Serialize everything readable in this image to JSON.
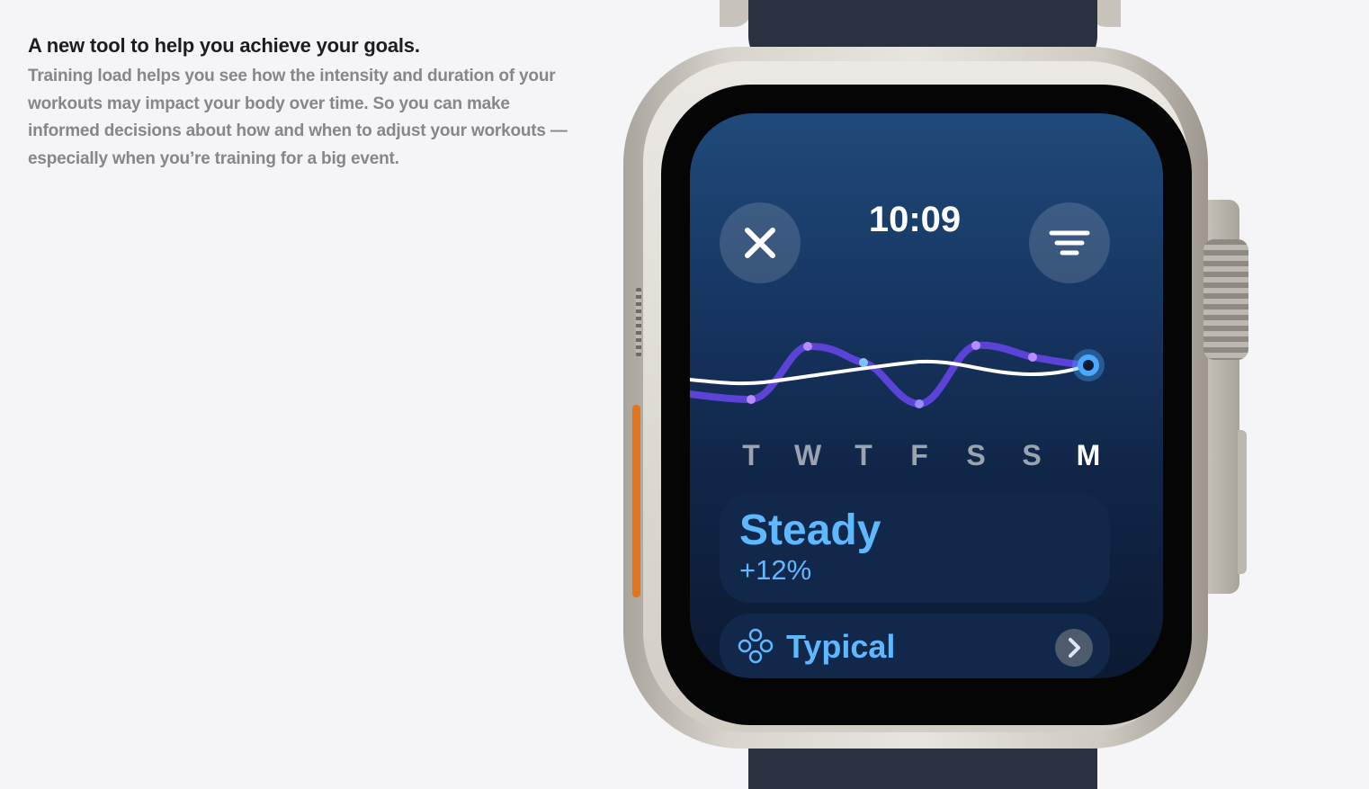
{
  "article": {
    "headline": "A new tool to help you achieve your goals.",
    "body": "Training load helps you see how the intensity and duration of your workouts may impact your body over time. So you can make informed decisions about how and when to adjust your workouts — especially when you’re training for a big event."
  },
  "watch": {
    "time": "10:09",
    "close_icon": "close-icon",
    "menu_icon": "filter-lines-icon",
    "days": [
      "T",
      "W",
      "T",
      "F",
      "S",
      "S",
      "M"
    ],
    "active_day": "M",
    "status": {
      "label": "Steady",
      "change": "+12%"
    },
    "typical": {
      "label": "Typical",
      "icon": "rings-icon",
      "chevron_icon": "chevron-right-icon"
    }
  },
  "colors": {
    "accent_blue": "#5fb7ff",
    "purple_line": "#6a4fe0",
    "active_dot": "#4aa8ff"
  }
}
